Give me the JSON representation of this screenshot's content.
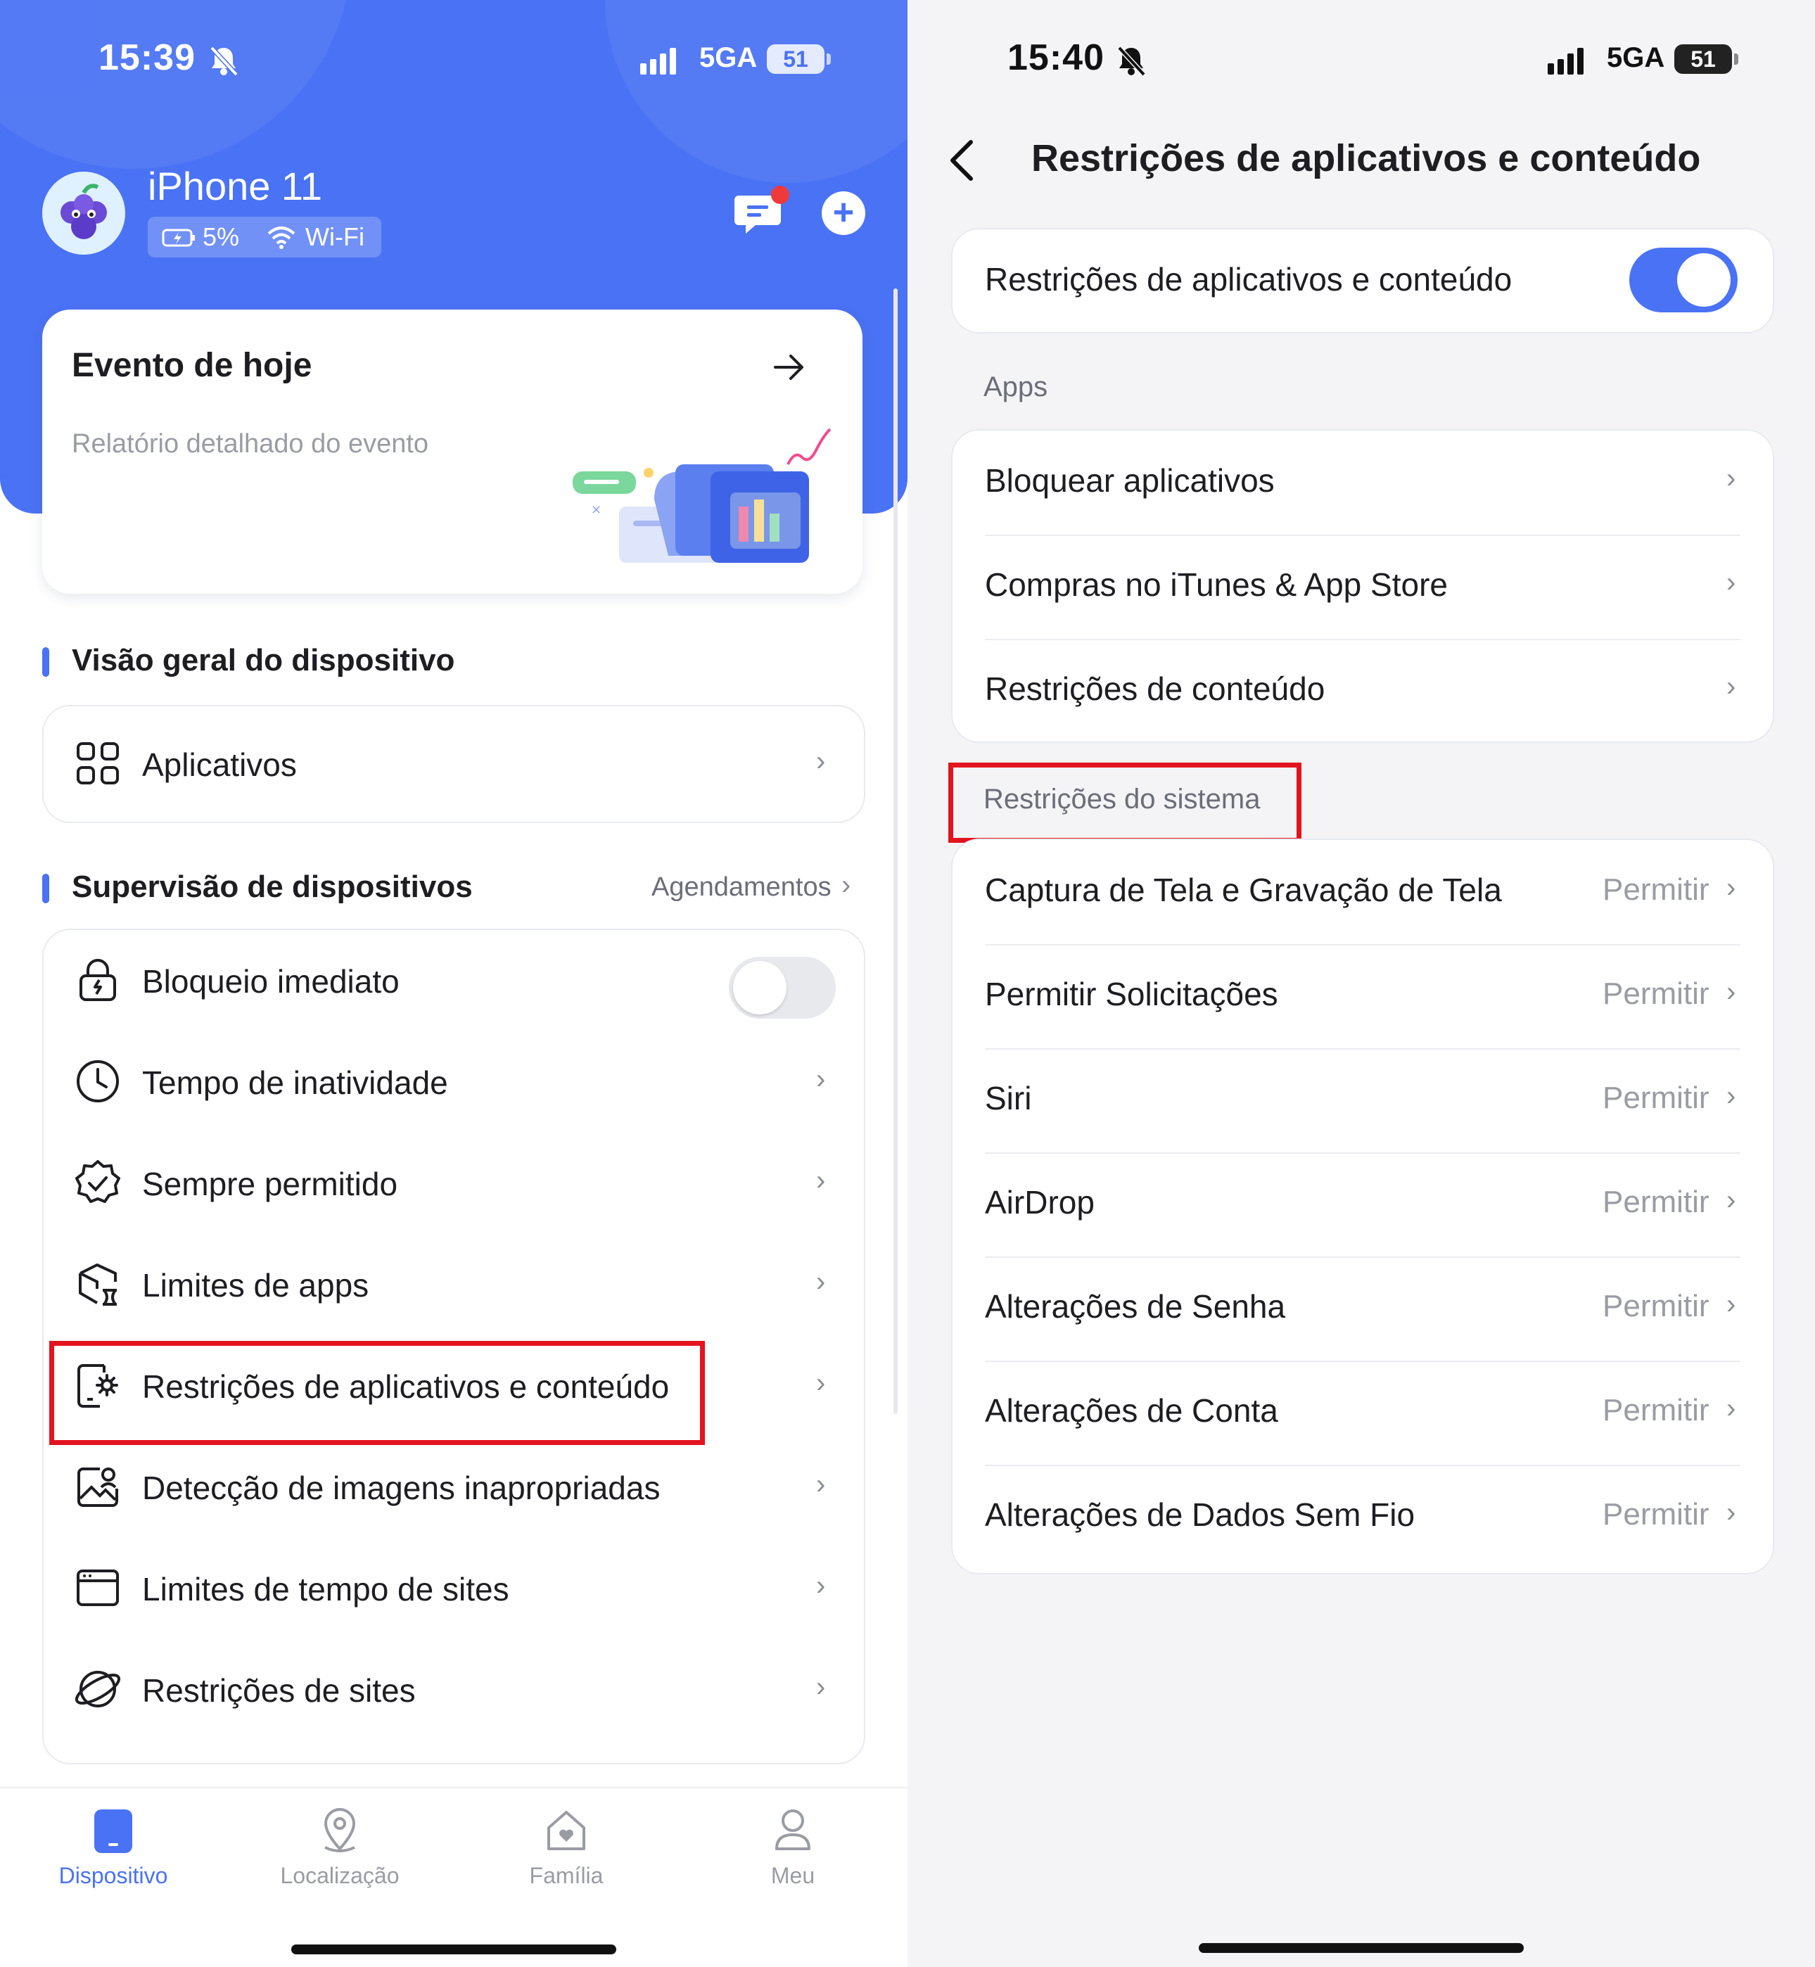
{
  "left": {
    "status": {
      "time": "15:39",
      "network": "5GA",
      "battery": "51"
    },
    "profile": {
      "device_name": "iPhone 11",
      "battery": "5%",
      "connection": "Wi-Fi"
    },
    "event_card": {
      "title": "Evento de hoje",
      "subtitle": "Relatório detalhado do evento"
    },
    "overview": {
      "title": "Visão geral do dispositivo",
      "apps_label": "Aplicativos"
    },
    "supervision": {
      "title": "Supervisão de dispositivos",
      "schedules_link": "Agendamentos",
      "items": [
        {
          "label": "Bloqueio imediato",
          "icon": "lock-icon",
          "control": "toggle",
          "on": false
        },
        {
          "label": "Tempo de inatividade",
          "icon": "clock-icon"
        },
        {
          "label": "Sempre permitido",
          "icon": "check-badge-icon"
        },
        {
          "label": "Limites de apps",
          "icon": "app-limit-icon"
        },
        {
          "label": "Restrições de aplicativos e conteúdo",
          "icon": "settings-doc-icon",
          "highlighted": true
        },
        {
          "label": "Detecção de imagens inapropriadas",
          "icon": "image-detect-icon"
        },
        {
          "label": "Limites de tempo de sites",
          "icon": "browser-icon"
        },
        {
          "label": "Restrições de sites",
          "icon": "planet-icon"
        }
      ]
    },
    "tabbar": [
      {
        "label": "Dispositivo",
        "icon": "device-icon",
        "active": true
      },
      {
        "label": "Localização",
        "icon": "location-pin-icon"
      },
      {
        "label": "Família",
        "icon": "home-heart-icon"
      },
      {
        "label": "Meu",
        "icon": "person-icon"
      }
    ]
  },
  "right": {
    "status": {
      "time": "15:40",
      "network": "5GA",
      "battery": "51"
    },
    "header": {
      "title": "Restrições de aplicativos e conteúdo"
    },
    "master_toggle": {
      "label": "Restrições de aplicativos e conteúdo",
      "on": true
    },
    "apps_section": {
      "title": "Apps",
      "items": [
        "Bloquear aplicativos",
        "Compras no iTunes & App Store",
        "Restrições de conteúdo"
      ]
    },
    "system_section": {
      "title": "Restrições do sistema",
      "items": [
        {
          "label": "Captura de Tela e Gravação de Tela",
          "value": "Permitir"
        },
        {
          "label": "Permitir Solicitações",
          "value": "Permitir"
        },
        {
          "label": "Siri",
          "value": "Permitir"
        },
        {
          "label": "AirDrop",
          "value": "Permitir"
        },
        {
          "label": "Alterações de Senha",
          "value": "Permitir"
        },
        {
          "label": "Alterações de Conta",
          "value": "Permitir"
        },
        {
          "label": "Alterações de Dados Sem Fio",
          "value": "Permitir"
        }
      ]
    }
  },
  "colors": {
    "accent": "#4a72f4",
    "highlight": "#e2141f",
    "notification_dot": "#f03a3a"
  }
}
